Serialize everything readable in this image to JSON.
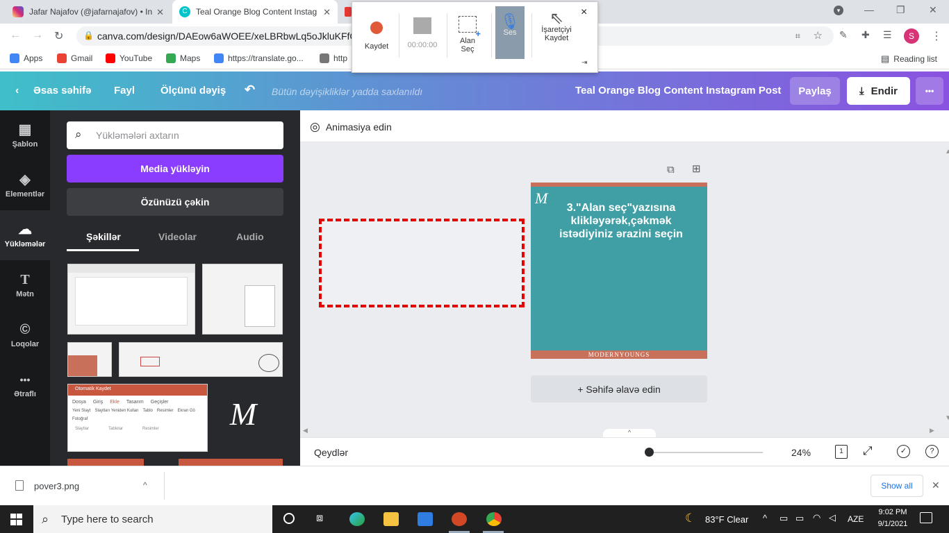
{
  "browser": {
    "tabs": [
      {
        "title": "Jafar Najafov (@jafarnajafov) • In",
        "color": "#d6249f"
      },
      {
        "title": "Teal Orange Blog Content Instag",
        "color": "#00c4cc"
      }
    ],
    "url": "canva.com/design/DAEow6aWOEE/xeLBRbwLq5oJkluKFfG(",
    "bookmarks": [
      {
        "label": "Apps",
        "color": "#4285f4"
      },
      {
        "label": "Gmail",
        "color": "#ea4335"
      },
      {
        "label": "YouTube",
        "color": "#ff0000"
      },
      {
        "label": "Maps",
        "color": "#34a853"
      },
      {
        "label": "https://translate.go...",
        "color": "#4285f4"
      },
      {
        "label": "http",
        "color": "#777777"
      }
    ],
    "reading_list": "Reading list",
    "profile_initial": "S"
  },
  "recorder": {
    "record_label": "Kaydet",
    "time": "00:00:00",
    "area_label_1": "Alan",
    "area_label_2": "Seç",
    "audio_label": "Ses",
    "pointer_label_1": "İşaretçiyi",
    "pointer_label_2": "Kaydet",
    "close": "×"
  },
  "header": {
    "home": "Əsas səhifə",
    "file": "Fayl",
    "resize": "Ölçünü dəyiş",
    "saved_status": "Bütün dəyişikliklər yadda saxlanıldı",
    "design_title": "Teal Orange Blog Content Instagram Post",
    "share": "Paylaş",
    "download": "Endir",
    "more": "•••"
  },
  "rail": [
    {
      "label": "Şablon",
      "icon": "▦"
    },
    {
      "label": "Elementlər",
      "icon": "◈"
    },
    {
      "label": "Yükləmələr",
      "icon": "☁"
    },
    {
      "label": "Mətn",
      "icon": "T"
    },
    {
      "label": "Loqolar",
      "icon": "©"
    },
    {
      "label": "Ətraflı",
      "icon": "•••"
    }
  ],
  "panel": {
    "search_placeholder": "Yükləmələri axtarın",
    "upload_button": "Media yükləyin",
    "record_button": "Özünüzü çəkin",
    "tabs": [
      "Şəkillər",
      "Videolar",
      "Audio"
    ],
    "thumb_text": {
      "autosave": "Otomatik Kaydet",
      "menu": [
        "Dosya",
        "Giriş",
        "Ekle",
        "Tasarım",
        "Geçişler"
      ],
      "tools": [
        "Yeni Slayt",
        "Slaytları Yeniden Kullan",
        "Tablo",
        "Resimler",
        "Ekran Gö",
        "Fotoğraf"
      ],
      "groups": [
        "Slaytlar",
        "Tablolar",
        "Resimler"
      ]
    }
  },
  "toolbar": {
    "animate": "Animasiya edin"
  },
  "design": {
    "text": "3.\"Alan seç\"yazısına klikləyərək,çəkmək istədiyiniz ərazini seçin",
    "footer": "MODERNYOUNGS",
    "teal": "#3f9fa4",
    "coral": "#c8705a"
  },
  "add_page": "+ Səhifə əlavə edin",
  "bottom": {
    "notes": "Qeydlər",
    "zoom": "24%",
    "page_count": "1"
  },
  "downloads": {
    "file": "pover3.png",
    "show_all": "Show all"
  },
  "taskbar": {
    "search": "Type here to search",
    "weather": "83°F  Clear",
    "lang": "AZE",
    "time": "9:02 PM",
    "date": "9/1/2021"
  }
}
